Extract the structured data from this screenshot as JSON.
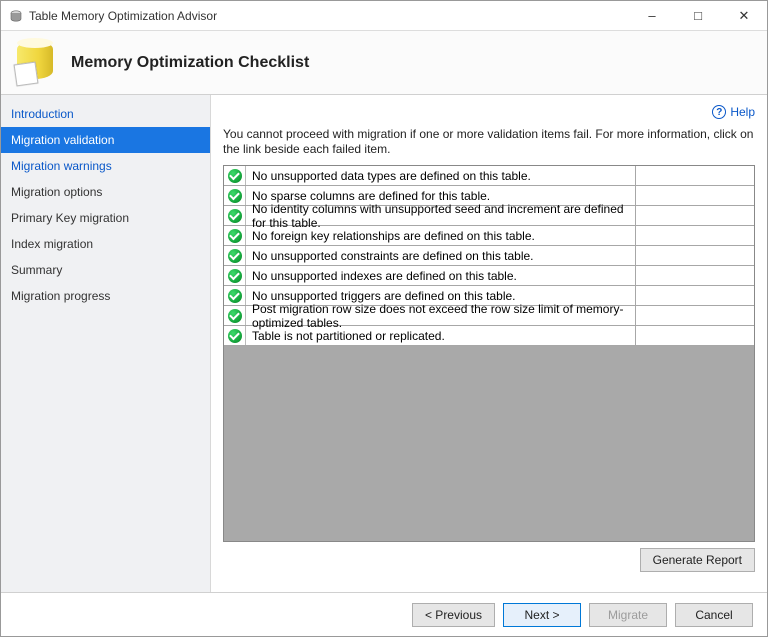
{
  "window": {
    "title": "Table Memory Optimization Advisor"
  },
  "header": {
    "title": "Memory Optimization Checklist"
  },
  "sidebar": {
    "items": [
      {
        "label": "Introduction"
      },
      {
        "label": "Migration validation"
      },
      {
        "label": "Migration warnings"
      },
      {
        "label": "Migration options"
      },
      {
        "label": "Primary Key migration"
      },
      {
        "label": "Index migration"
      },
      {
        "label": "Summary"
      },
      {
        "label": "Migration progress"
      }
    ]
  },
  "main": {
    "help": "Help",
    "description": "You cannot proceed with migration if one or more validation items fail. For more information, click on the link beside each failed item.",
    "checks": [
      "No unsupported data types are defined on this table.",
      "No sparse columns are defined for this table.",
      "No identity columns with unsupported seed and increment are defined for this table.",
      "No foreign key relationships are defined on this table.",
      "No unsupported constraints are defined on this table.",
      "No unsupported indexes are defined on this table.",
      "No unsupported triggers are defined on this table.",
      "Post migration row size does not exceed the row size limit of memory-optimized tables.",
      "Table is not partitioned or replicated."
    ],
    "generate_report": "Generate Report"
  },
  "footer": {
    "previous": "< Previous",
    "next": "Next >",
    "migrate": "Migrate",
    "cancel": "Cancel"
  }
}
